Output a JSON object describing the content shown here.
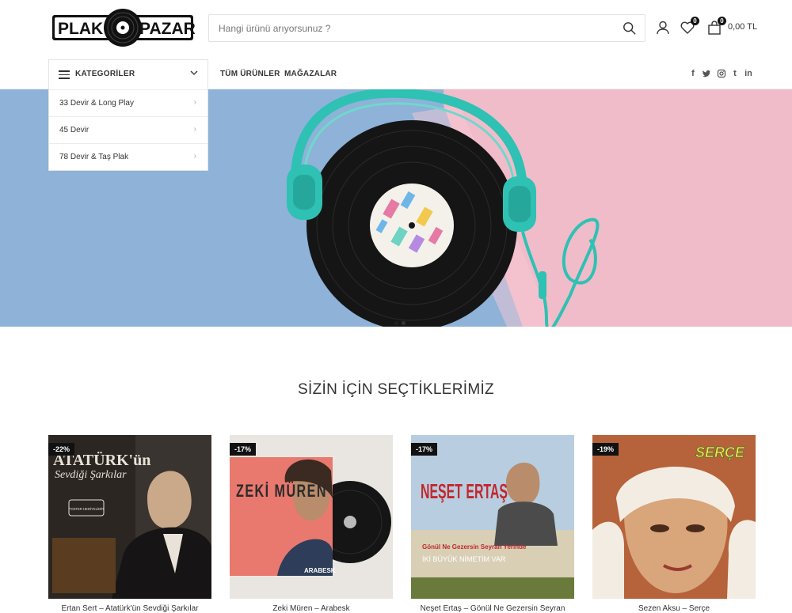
{
  "header": {
    "logo_left": "PLAK",
    "logo_right": "PAZARI",
    "search_placeholder": "Hangi ürünü arıyorsunuz ?",
    "wishlist_count": "0",
    "cart_count": "0",
    "cart_total": "0,00 TL"
  },
  "nav": {
    "categories_label": "KATEGORİLER",
    "links": [
      "TÜM ÜRÜNLER",
      "MAĞAZALAR"
    ],
    "social": [
      "facebook-icon",
      "twitter-icon",
      "instagram-icon",
      "tumblr-icon",
      "linkedin-icon"
    ]
  },
  "categories": [
    {
      "label": "33 Devir & Long Play"
    },
    {
      "label": "45 Devir"
    },
    {
      "label": "78 Devir & Taş Plak"
    }
  ],
  "hero": {
    "colors": {
      "blue": "#8eb2d8",
      "pink": "#f0bcc9",
      "headphone": "#2fc1b3"
    }
  },
  "section": {
    "title": "SİZİN İÇİN SEÇTİKLERİMİZ"
  },
  "products": [
    {
      "discount": "-22%",
      "title": "Ertan Sert – Atatürk'ün Sevdiği Şarkılar",
      "cover_text": "ATATÜRK'ün",
      "cover_sub": "Sevdiği Şarkılar",
      "cover_badge": "POSTER HEDİYELİDİR"
    },
    {
      "discount": "-17%",
      "title": "Zeki Müren – Arabesk",
      "cover_text": "ZEKİ MÜREN",
      "cover_sub": "ARABESK"
    },
    {
      "discount": "-17%",
      "title": "Neşet Ertaş – Gönül Ne Gezersin Seyran",
      "cover_text": "NEŞET ERTAŞ",
      "cover_sub": "Gönül Ne Gezersin Seyran Yerinde",
      "cover_sub2": "İKİ BÜYÜK NİMETİM VAR"
    },
    {
      "discount": "-19%",
      "title": "Sezen Aksu – Serçe",
      "cover_text": "SERÇE"
    }
  ]
}
